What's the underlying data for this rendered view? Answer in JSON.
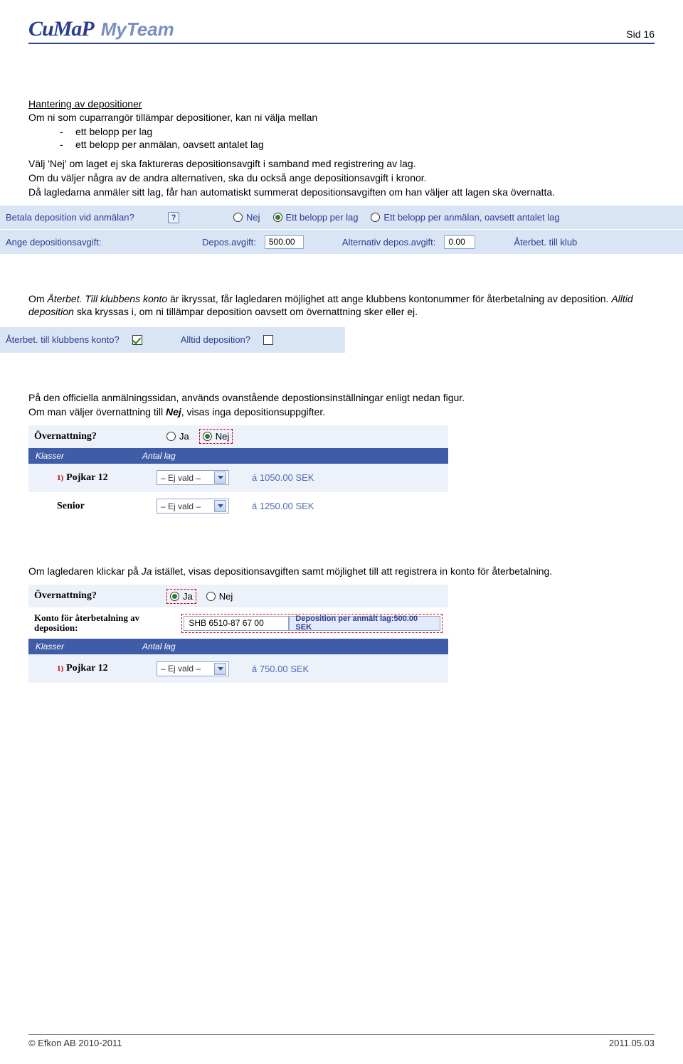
{
  "header": {
    "logo1": "CuMaP",
    "logo2": "MyTeam",
    "pagenum": "Sid 16"
  },
  "sec1": {
    "title": "Hantering av depositioner",
    "p1": "Om ni som cuparrangör tillämpar depositioner, kan ni välja mellan",
    "b1": "ett belopp per lag",
    "b2": "ett belopp per anmälan, oavsett antalet lag",
    "p2a": "Välj 'Nej' om laget ej ska faktureras depositionsavgift i samband med registrering av lag.",
    "p2b": "Om du väljer några av de andra alternativen, ska du också ange depositionsavgift i kronor.",
    "p2c": "Då lagledarna anmäler sitt lag, får han automatiskt summerat depositionsavgiften om han väljer att lagen ska övernatta."
  },
  "img1": {
    "q1": "Betala deposition vid anmälan?",
    "r1": "Nej",
    "r2": "Ett belopp per lag",
    "r3": "Ett belopp per anmälan, oavsett antalet lag",
    "q2": "Ange depositionsavgift:",
    "l1": "Depos.avgift:",
    "v1": "500.00",
    "l2": "Alternativ depos.avgift:",
    "v2": "0.00",
    "l3": "Återbet. till klub"
  },
  "sec2": {
    "p_parts": {
      "a": "Om ",
      "b": "Återbet. Till klubbens konto",
      "c": " är ikryssat, får lagledaren möjlighet att ange klubbens kontonummer för återbetalning av deposition. ",
      "d": "Alltid deposition",
      "e": " ska kryssas i,  om ni tillämpar deposition oavsett om övernattning sker eller ej."
    }
  },
  "img2": {
    "l1": "Återbet. till klubbens konto?",
    "l2": "Alltid deposition?"
  },
  "sec3": {
    "p1": "På den officiella anmälningssidan, används ovanstående depostionsinställningar enligt nedan figur.",
    "p2a": "Om man väljer övernattning till ",
    "p2b": "Nej",
    "p2c": ", visas inga depositionsuppgifter."
  },
  "img3": {
    "ov": "Övernattning?",
    "ja": "Ja",
    "nej": "Nej",
    "hk": "Klasser",
    "ha": "Antal lag",
    "r1": {
      "sup": "1)",
      "name": "Pojkar 12",
      "sel": "– Ej vald –",
      "price": "á 1050.00 SEK"
    },
    "r2": {
      "name": "Senior",
      "sel": "– Ej vald –",
      "price": "á 1250.00 SEK"
    }
  },
  "sec4": {
    "p_a": "Om lagledaren klickar på ",
    "p_b": "Ja",
    "p_c": " istället, visas depositionsavgiften samt möjlighet till att registrera in konto för återbetalning."
  },
  "img4": {
    "ov": "Övernattning?",
    "ja": "Ja",
    "nej": "Nej",
    "kontolbl": "Konto för återbetalning av deposition:",
    "kontoval": "SHB 6510-87 67 00",
    "depinfo": "Deposition per anmält lag:500.00 SEK",
    "hk": "Klasser",
    "ha": "Antal lag",
    "r1": {
      "sup": "1)",
      "name": "Pojkar 12",
      "sel": "– Ej vald –",
      "price": "á 750.00 SEK"
    }
  },
  "footer": {
    "left": "© Efkon AB 2010-2011",
    "right": "2011.05.03"
  }
}
